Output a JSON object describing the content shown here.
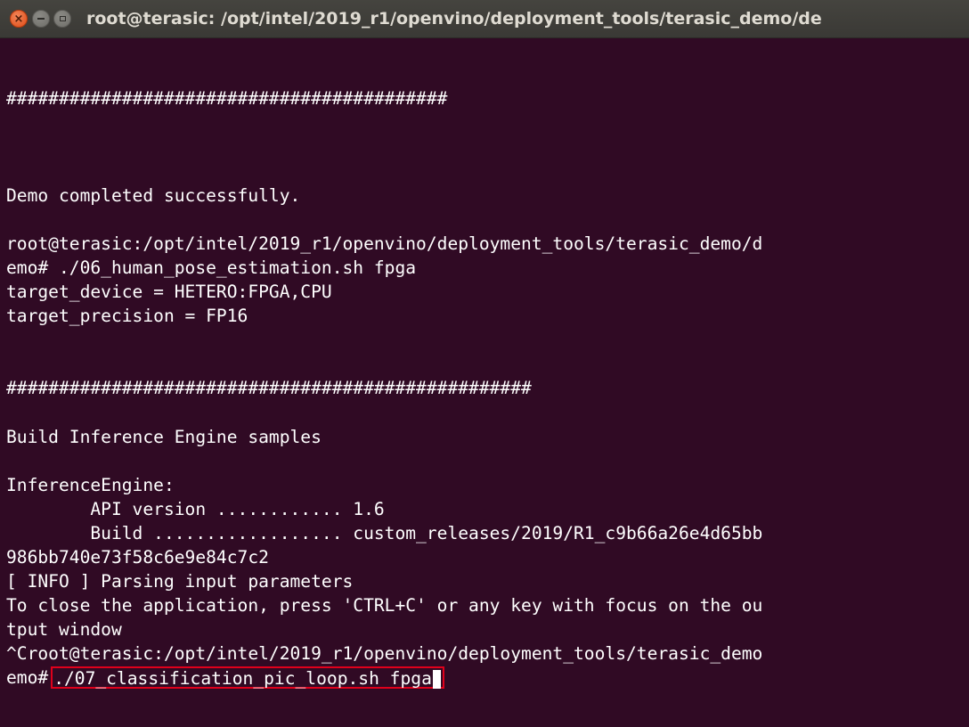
{
  "window": {
    "title": "root@terasic: /opt/intel/2019_r1/openvino/deployment_tools/terasic_demo/de",
    "buttons": {
      "close_glyph": "×",
      "close_icon": "close-icon",
      "minimize_icon": "minimize-icon",
      "maximize_icon": "maximize-icon"
    }
  },
  "terminal": {
    "lines": [
      "",
      "",
      "##########################################",
      "",
      "",
      "",
      "Demo completed successfully.",
      "",
      "root@terasic:/opt/intel/2019_r1/openvino/deployment_tools/terasic_demo/d",
      "emo# ./06_human_pose_estimation.sh fpga",
      "target_device = HETERO:FPGA,CPU",
      "target_precision = FP16",
      "",
      "",
      "##################################################",
      "",
      "Build Inference Engine samples",
      "",
      "InferenceEngine:",
      "        API version ............ 1.6",
      "        Build .................. custom_releases/2019/R1_c9b66a26e4d65bb",
      "986bb740e73f58c6e9e84c7c2",
      "[ INFO ] Parsing input parameters",
      "To close the application, press 'CTRL+C' or any key with focus on the ou",
      "tput window",
      "^Croot@terasic:/opt/intel/2019_r1/openvino/deployment_tools/terasic_demo"
    ],
    "prompt": {
      "prefix": "emo#",
      "command": "./07_classification_pic_loop.sh fpga",
      "highlight_color": "#e0001b"
    }
  },
  "colors": {
    "background": "#300a24",
    "text": "#ffffff",
    "titlebar": "#3c3b37",
    "close_button": "#e95420"
  }
}
